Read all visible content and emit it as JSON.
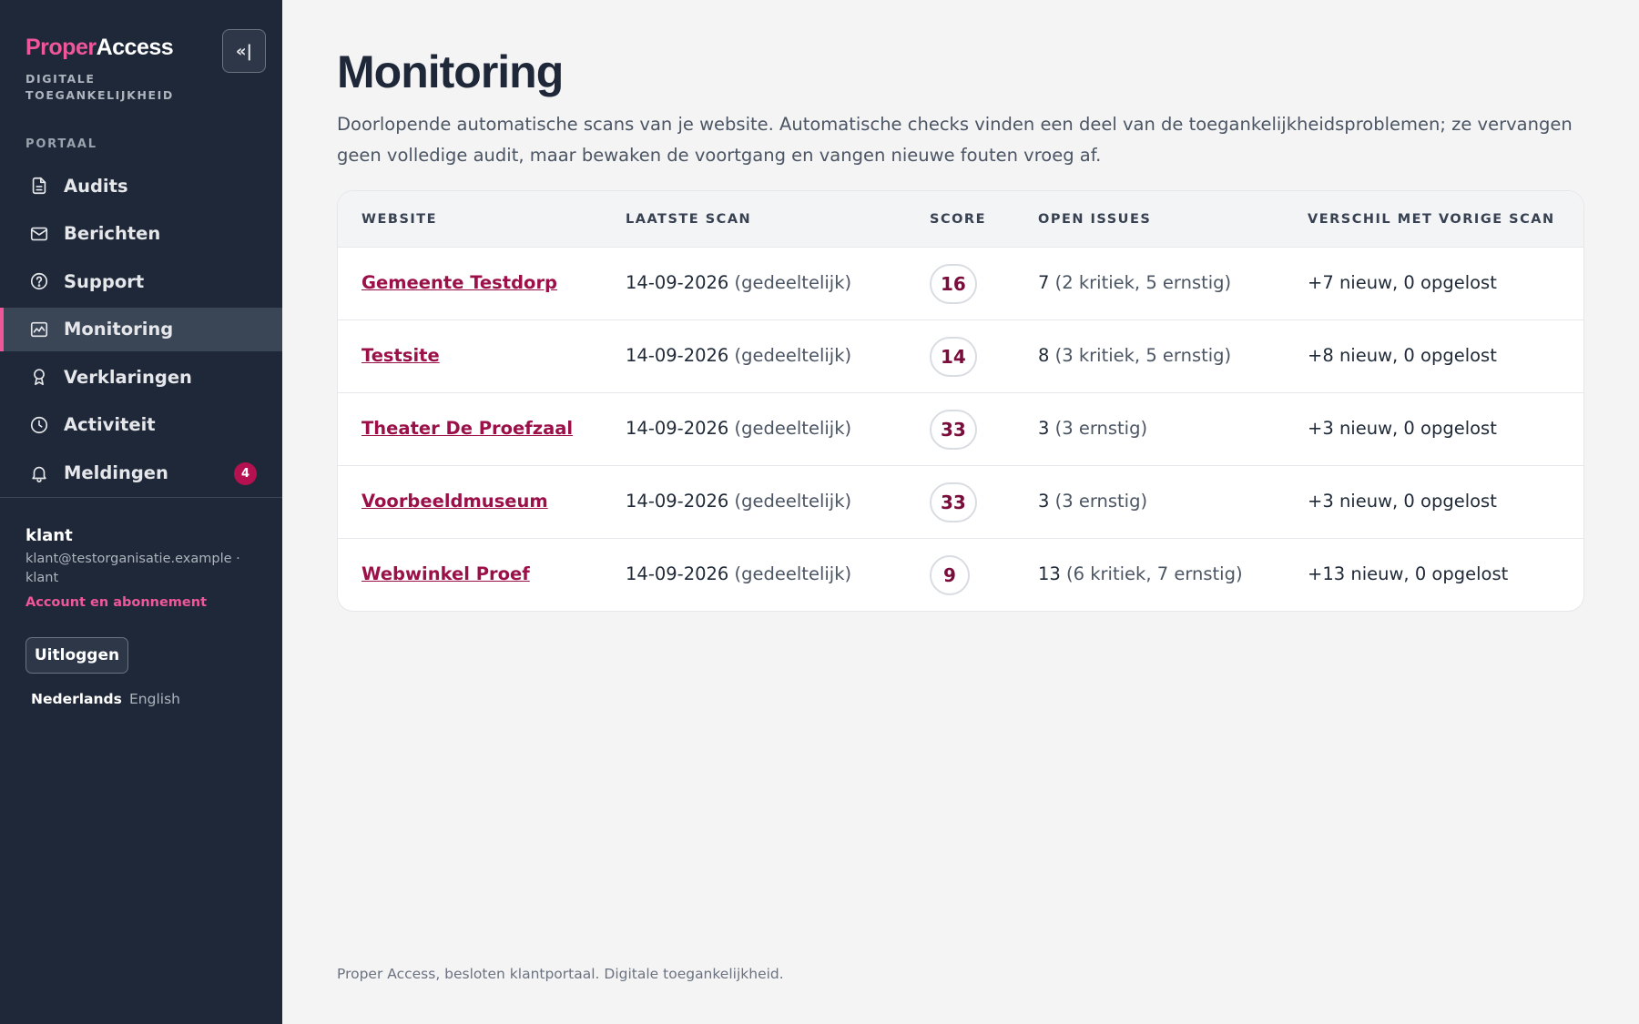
{
  "brand": {
    "part1": "Proper",
    "part2": "Access",
    "tagline": "DIGITALE TOEGANKELIJKHEID",
    "collapse_label": "«|"
  },
  "sidebar": {
    "section_label": "PORTAAL",
    "items": [
      {
        "label": "Audits",
        "icon": "document-icon"
      },
      {
        "label": "Berichten",
        "icon": "mail-icon"
      },
      {
        "label": "Support",
        "icon": "help-circle-icon"
      },
      {
        "label": "Monitoring",
        "icon": "chart-icon",
        "active": true
      },
      {
        "label": "Verklaringen",
        "icon": "award-icon"
      },
      {
        "label": "Activiteit",
        "icon": "clock-icon"
      },
      {
        "label": "Meldingen",
        "icon": "bell-icon",
        "badge": "4"
      }
    ],
    "user": {
      "name": "klant",
      "email": "klant@testorganisatie.example · klant",
      "account_link": "Account en abonnement",
      "logout": "Uitloggen"
    },
    "languages": {
      "nl": "Nederlands",
      "en": "English"
    }
  },
  "main": {
    "title": "Monitoring",
    "intro": "Doorlopende automatische scans van je website. Automatische checks vinden een deel van de toegankelijkheidsproblemen; ze vervangen geen volledige audit, maar bewaken de voortgang en vangen nieuwe fouten vroeg af.",
    "table": {
      "headers": [
        "WEBSITE",
        "LAATSTE SCAN",
        "SCORE",
        "OPEN ISSUES",
        "VERSCHIL MET VORIGE SCAN"
      ],
      "rows": [
        {
          "website": "Gemeente Testdorp",
          "date": "14-09-2026",
          "scan_note": "(gedeeltelijk)",
          "score": "16",
          "issues_count": "7",
          "issues_detail": "(2 kritiek, 5 ernstig)",
          "diff": "+7 nieuw, 0 opgelost"
        },
        {
          "website": "Testsite",
          "date": "14-09-2026",
          "scan_note": "(gedeeltelijk)",
          "score": "14",
          "issues_count": "8",
          "issues_detail": "(3 kritiek, 5 ernstig)",
          "diff": "+8 nieuw, 0 opgelost"
        },
        {
          "website": "Theater De Proefzaal",
          "date": "14-09-2026",
          "scan_note": "(gedeeltelijk)",
          "score": "33",
          "issues_count": "3",
          "issues_detail": "(3 ernstig)",
          "diff": "+3 nieuw, 0 opgelost"
        },
        {
          "website": "Voorbeeldmuseum",
          "date": "14-09-2026",
          "scan_note": "(gedeeltelijk)",
          "score": "33",
          "issues_count": "3",
          "issues_detail": "(3 ernstig)",
          "diff": "+3 nieuw, 0 opgelost"
        },
        {
          "website": "Webwinkel Proef",
          "date": "14-09-2026",
          "scan_note": "(gedeeltelijk)",
          "score": "9",
          "issues_count": "13",
          "issues_detail": "(6 kritiek, 7 ernstig)",
          "diff": "+13 nieuw, 0 opgelost"
        }
      ]
    }
  },
  "footer": "Proper Access, besloten klantportaal. Digitale toegankelijkheid.",
  "colors": {
    "accent": "#f0569a",
    "sidebar_bg": "#1f2838",
    "link": "#9b1048",
    "badge": "#b5104f"
  }
}
